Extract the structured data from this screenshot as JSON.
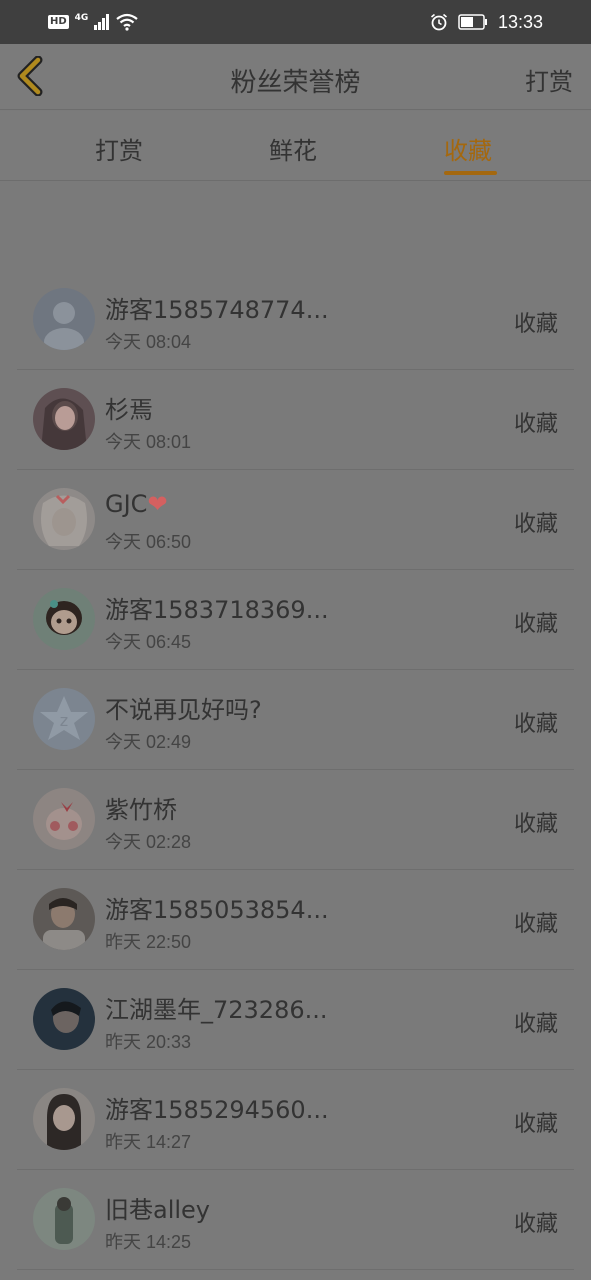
{
  "status_bar": {
    "hd": "HD",
    "network": "4G",
    "time": "13:33"
  },
  "header": {
    "title": "粉丝荣誉榜",
    "right_action": "打赏"
  },
  "tabs": [
    {
      "label": "打赏",
      "active": false
    },
    {
      "label": "鲜花",
      "active": false
    },
    {
      "label": "收藏",
      "active": true
    }
  ],
  "colors": {
    "accent": "#a4680f",
    "overlay_background": "#7a7a7a",
    "status_bar": "#3f3f3f"
  },
  "fans": [
    {
      "name": "游客1585748774...",
      "time": "今天 08:04",
      "action": "收藏",
      "avatar": "default-avatar"
    },
    {
      "name": "杉焉",
      "time": "今天 08:01",
      "action": "收藏",
      "avatar": "photo-avatar"
    },
    {
      "name": "GJC",
      "name_suffix_icon": "heart-icon",
      "time": "今天 06:50",
      "action": "收藏",
      "avatar": "illustration-avatar"
    },
    {
      "name": "游客1583718369...",
      "time": "今天 06:45",
      "action": "收藏",
      "avatar": "cartoon-girl-avatar"
    },
    {
      "name": "不说再见好吗?",
      "time": "今天 02:49",
      "action": "收藏",
      "avatar": "qq-avatar"
    },
    {
      "name": "紫竹桥",
      "time": "今天 02:28",
      "action": "收藏",
      "avatar": "anime-avatar"
    },
    {
      "name": "游客1585053854...",
      "time": "昨天 22:50",
      "action": "收藏",
      "avatar": "photo-avatar"
    },
    {
      "name": "江湖墨年_723286...",
      "time": "昨天 20:33",
      "action": "收藏",
      "avatar": "photo-avatar"
    },
    {
      "name": "游客1585294560...",
      "time": "昨天 14:27",
      "action": "收藏",
      "avatar": "photo-avatar"
    },
    {
      "name": "旧巷alley",
      "time": "昨天 14:25",
      "action": "收藏",
      "avatar": "photo-avatar"
    }
  ]
}
